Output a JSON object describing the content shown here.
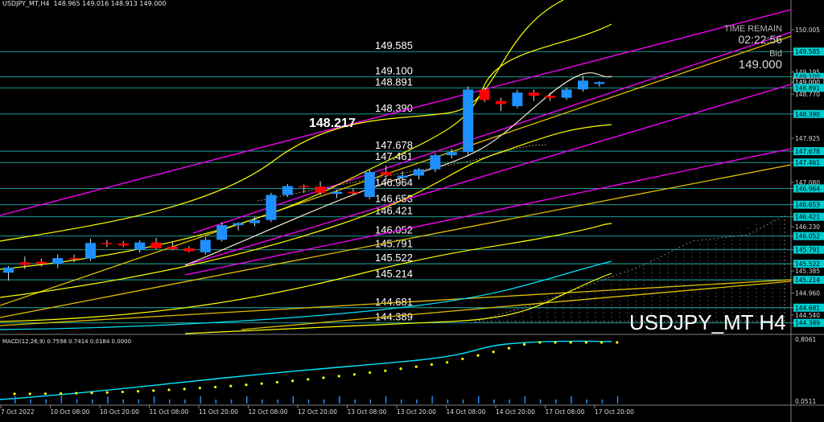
{
  "header": {
    "symbol_tf": "USDJPY_MT,H4",
    "ohlc": "148.965 149.016 148.913 149.000"
  },
  "info": {
    "time_remain_label": "TIME REMAIN",
    "time_remain_value": "02:22:56",
    "bid_label": "Bid",
    "bid_value": "149.000"
  },
  "watermark": "USDJPY_MT H4",
  "macd": {
    "label": "MACD(12,26,9)",
    "values": "0.7598 0.7414 0.0184 0.0000",
    "axis_labels": [
      "0.8061",
      "0.0511"
    ]
  },
  "colors": {
    "background": "#000000",
    "bull_candle": "#1e90ff",
    "bear_candle": "#ff0000",
    "level_line": "#20b2aa",
    "channel": "#ff00ff",
    "trend_yellow": "#ffff00",
    "ma_orange": "#ffb000",
    "macd_line": "#00e5ff",
    "macd_signal": "#ffff00",
    "price_box": "#00ced1"
  },
  "chart_data": {
    "type": "candlestick",
    "price_axis": {
      "min": 144.2,
      "max": 150.45,
      "ticks": [
        "150.005",
        "149.585",
        "149.195",
        "149.100",
        "149.000",
        "148.891",
        "148.770",
        "148.390",
        "147.925",
        "147.678",
        "147.461",
        "147.080",
        "146.964",
        "146.653",
        "146.421",
        "146.230",
        "146.052",
        "145.791",
        "145.522",
        "145.385",
        "145.214",
        "144.960",
        "144.681",
        "144.540",
        "144.389"
      ],
      "boxed_ticks": [
        "149.585",
        "149.100",
        "149.000",
        "148.891",
        "148.390",
        "147.678",
        "147.461",
        "146.964",
        "146.653",
        "146.421",
        "146.052",
        "145.791",
        "145.522",
        "145.214",
        "144.681",
        "144.389"
      ]
    },
    "time_axis": [
      "7 Oct 2022",
      "10 Oct 08:00",
      "10 Oct 20:00",
      "11 Oct 08:00",
      "11 Oct 20:00",
      "12 Oct 08:00",
      "12 Oct 20:00",
      "13 Oct 08:00",
      "13 Oct 20:00",
      "14 Oct 08:00",
      "14 Oct 20:00",
      "17 Oct 08:00",
      "17 Oct 20:00"
    ],
    "levels": [
      {
        "value": 149.585,
        "label": "149.585"
      },
      {
        "value": 149.1,
        "label": "149.100"
      },
      {
        "value": 148.891,
        "label": "148.891"
      },
      {
        "value": 148.39,
        "label": "148.390"
      },
      {
        "value": 147.678,
        "label": "147.678"
      },
      {
        "value": 147.461,
        "label": "147.461"
      },
      {
        "value": 146.964,
        "label": "146.964"
      },
      {
        "value": 146.653,
        "label": "146.653"
      },
      {
        "value": 146.421,
        "label": "146.421"
      },
      {
        "value": 146.052,
        "label": "146.052"
      },
      {
        "value": 145.791,
        "label": "145.791"
      },
      {
        "value": 145.522,
        "label": "145.522"
      },
      {
        "value": 145.214,
        "label": "145.214"
      },
      {
        "value": 144.681,
        "label": "144.681"
      },
      {
        "value": 144.389,
        "label": "144.389"
      }
    ],
    "annotation": {
      "value": 148.217,
      "label": "148.217"
    },
    "candles": [
      {
        "o": 145.35,
        "h": 145.48,
        "l": 145.2,
        "c": 145.45
      },
      {
        "o": 145.55,
        "h": 145.66,
        "l": 145.42,
        "c": 145.5
      },
      {
        "o": 145.56,
        "h": 145.62,
        "l": 145.47,
        "c": 145.52
      },
      {
        "o": 145.52,
        "h": 145.7,
        "l": 145.44,
        "c": 145.63
      },
      {
        "o": 145.63,
        "h": 145.7,
        "l": 145.55,
        "c": 145.62
      },
      {
        "o": 145.62,
        "h": 146.0,
        "l": 145.58,
        "c": 145.92
      },
      {
        "o": 145.92,
        "h": 145.98,
        "l": 145.84,
        "c": 145.9
      },
      {
        "o": 145.91,
        "h": 145.96,
        "l": 145.84,
        "c": 145.87
      },
      {
        "o": 145.79,
        "h": 145.97,
        "l": 145.74,
        "c": 145.93
      },
      {
        "o": 145.93,
        "h": 146.02,
        "l": 145.8,
        "c": 145.82
      },
      {
        "o": 145.85,
        "h": 145.93,
        "l": 145.78,
        "c": 145.8
      },
      {
        "o": 145.82,
        "h": 145.86,
        "l": 145.74,
        "c": 145.76
      },
      {
        "o": 145.74,
        "h": 146.03,
        "l": 145.7,
        "c": 145.98
      },
      {
        "o": 145.98,
        "h": 146.32,
        "l": 145.95,
        "c": 146.26
      },
      {
        "o": 146.26,
        "h": 146.32,
        "l": 146.16,
        "c": 146.3
      },
      {
        "o": 146.3,
        "h": 146.42,
        "l": 146.24,
        "c": 146.36
      },
      {
        "o": 146.36,
        "h": 146.88,
        "l": 146.32,
        "c": 146.84
      },
      {
        "o": 146.84,
        "h": 147.05,
        "l": 146.8,
        "c": 147.01
      },
      {
        "o": 147.01,
        "h": 147.04,
        "l": 146.88,
        "c": 147.0
      },
      {
        "o": 147.0,
        "h": 147.1,
        "l": 146.84,
        "c": 146.88
      },
      {
        "o": 146.86,
        "h": 146.94,
        "l": 146.78,
        "c": 146.9
      },
      {
        "o": 146.9,
        "h": 146.96,
        "l": 146.84,
        "c": 146.87
      },
      {
        "o": 146.8,
        "h": 147.32,
        "l": 146.76,
        "c": 147.28
      },
      {
        "o": 147.28,
        "h": 147.4,
        "l": 147.12,
        "c": 147.22
      },
      {
        "o": 147.17,
        "h": 147.29,
        "l": 147.06,
        "c": 147.21
      },
      {
        "o": 147.21,
        "h": 147.36,
        "l": 147.14,
        "c": 147.33
      },
      {
        "o": 147.33,
        "h": 147.64,
        "l": 147.28,
        "c": 147.6
      },
      {
        "o": 147.6,
        "h": 147.72,
        "l": 147.54,
        "c": 147.66
      },
      {
        "o": 147.66,
        "h": 148.92,
        "l": 147.58,
        "c": 148.86
      },
      {
        "o": 148.86,
        "h": 148.9,
        "l": 148.62,
        "c": 148.66
      },
      {
        "o": 148.64,
        "h": 148.7,
        "l": 148.45,
        "c": 148.58
      },
      {
        "o": 148.54,
        "h": 148.85,
        "l": 148.5,
        "c": 148.8
      },
      {
        "o": 148.8,
        "h": 148.86,
        "l": 148.64,
        "c": 148.74
      },
      {
        "o": 148.74,
        "h": 148.8,
        "l": 148.64,
        "c": 148.7
      },
      {
        "o": 148.7,
        "h": 148.9,
        "l": 148.66,
        "c": 148.86
      },
      {
        "o": 148.86,
        "h": 149.12,
        "l": 148.82,
        "c": 149.03
      },
      {
        "o": 148.965,
        "h": 149.016,
        "l": 148.913,
        "c": 149.0
      }
    ]
  }
}
